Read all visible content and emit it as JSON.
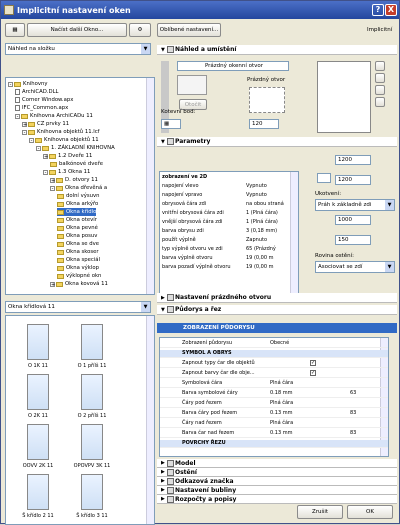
{
  "window": {
    "title": "Implicitní nastavení oken",
    "help": "?",
    "close": "X"
  },
  "left": {
    "load_button": "Načíst další Okno...",
    "view_combo": "Náhled na složku",
    "tree": [
      {
        "label": "Knihovny",
        "indent": 0,
        "type": "folder",
        "exp": "-"
      },
      {
        "label": "ArchiCAD.DLL",
        "indent": 1,
        "type": "file"
      },
      {
        "label": "Corner Window.apx",
        "indent": 1,
        "type": "file"
      },
      {
        "label": "IFC_Common.apx",
        "indent": 1,
        "type": "file"
      },
      {
        "label": "Knihovna ArchiCADu 11",
        "indent": 1,
        "type": "folder",
        "exp": "-"
      },
      {
        "label": "CZ prvky 11",
        "indent": 2,
        "type": "folder",
        "exp": "+"
      },
      {
        "label": "Knihovna objektů 11.lcf",
        "indent": 2,
        "type": "folder",
        "exp": "-"
      },
      {
        "label": "Knihovna objektů 11",
        "indent": 3,
        "type": "folder",
        "exp": "-"
      },
      {
        "label": "1. ZÁKLADNÍ KNIHOVNA",
        "indent": 4,
        "type": "folder",
        "exp": "-"
      },
      {
        "label": "1.2 Dveře 11",
        "indent": 5,
        "type": "folder",
        "exp": "+"
      },
      {
        "label": "balkónové dveře",
        "indent": 6,
        "type": "folder"
      },
      {
        "label": "1.3 Okna 11",
        "indent": 5,
        "type": "folder",
        "exp": "-"
      },
      {
        "label": "D. otvory 11",
        "indent": 6,
        "type": "folder",
        "exp": "+"
      },
      {
        "label": "Okna dřevěná a",
        "indent": 6,
        "type": "folder",
        "exp": "-"
      },
      {
        "label": "dolní výsuvn",
        "indent": 7,
        "type": "folder"
      },
      {
        "label": "Okna arkýřo",
        "indent": 7,
        "type": "folder"
      },
      {
        "label": "Okna křídlo",
        "indent": 7,
        "type": "folder",
        "selected": true
      },
      {
        "label": "Okna otevír",
        "indent": 7,
        "type": "folder"
      },
      {
        "label": "Okna pevné",
        "indent": 7,
        "type": "folder"
      },
      {
        "label": "Okna posuv",
        "indent": 7,
        "type": "folder"
      },
      {
        "label": "Okna se dve",
        "indent": 7,
        "type": "folder"
      },
      {
        "label": "Okna skoser",
        "indent": 7,
        "type": "folder"
      },
      {
        "label": "Okna speciál",
        "indent": 7,
        "type": "folder"
      },
      {
        "label": "Okna výklop",
        "indent": 7,
        "type": "folder"
      },
      {
        "label": "výklopné okn",
        "indent": 7,
        "type": "folder"
      },
      {
        "label": "Okna kovová 11",
        "indent": 6,
        "type": "folder",
        "exp": "+"
      }
    ],
    "gallery_combo": "Okna křídlová 11",
    "gallery": [
      "O 1K 11",
      "O 1 přílš 11",
      "O 2K 11",
      "O 2 přílš 11",
      "OOVV 2K 11",
      "OPOVPV 3K 11",
      "Š křídlo 2 11",
      "Š křídlo 3 11"
    ]
  },
  "right": {
    "favorites_button": "Oblíbené nastavení...",
    "default_label": "Implicitní",
    "section1": {
      "title": "Náhled a umístění",
      "ref_bar": "Prázdný okenní otvor",
      "ref_label": "Prázdný otvor",
      "flip_label": "Otočit",
      "anchor_label": "Kotevní bod:",
      "anchor_value": "120"
    },
    "section2": {
      "title": "Parametry",
      "width": "1200",
      "height": "1200",
      "anchor_label": "Ukotvení:",
      "anchor_value": "Práh k základně zdi",
      "sill": "1000",
      "depth": "150",
      "reveal_label": "Rovina ostění:",
      "reveal_value": "Asociovat se zdí"
    },
    "params": [
      {
        "name": "zobrazení ve 2D",
        "value": "",
        "bold": true
      },
      {
        "name": "napojení vlevo",
        "value": "Vypnuto"
      },
      {
        "name": "napojení vpravo",
        "value": "Vypnuto"
      },
      {
        "name": "obrysová čára zdi",
        "value": "na obou straná"
      },
      {
        "name": "vnitřní obrysová čára zdi",
        "value": "1 (Plná čára)"
      },
      {
        "name": "vnější obrysová čára zdi",
        "value": "1 (Plná čára)"
      },
      {
        "name": "barva obrysu zdi",
        "value": "3 (0,18 mm)"
      },
      {
        "name": "použít výplně",
        "value": "Zapnuto"
      },
      {
        "name": "typ výplně otvoru ve zdi",
        "value": "65 (Prázdný"
      },
      {
        "name": "barva výplně otvoru",
        "value": "19 (0,00 m"
      },
      {
        "name": "barva pozadí výplně otvoru",
        "value": "19 (0,00 m"
      }
    ],
    "section3": {
      "title": "Nastavení prázdného otvoru"
    },
    "section4": {
      "title": "Půdorys a řez"
    },
    "floor_header": "ZOBRAZENÍ PŮDORYSU",
    "floor_rows": [
      {
        "a": "Zobrazení půdorysu",
        "b": "Obecné",
        "c": "",
        "kind": "row"
      },
      {
        "a": "SYMBOL A OBRYS",
        "b": "",
        "c": "",
        "kind": "group"
      },
      {
        "a": "Zapnout typy čar dle objektů",
        "b": "",
        "c": "",
        "kind": "check"
      },
      {
        "a": "Zapnout barvy čar dle obje...",
        "b": "",
        "c": "",
        "kind": "check"
      },
      {
        "a": "Symbolová čára",
        "b": "Plná čára",
        "c": "",
        "kind": "row"
      },
      {
        "a": "Barva symbolové čáry",
        "b": "0.18 mm",
        "c": "63",
        "kind": "row"
      },
      {
        "a": "Čáry pod řezem",
        "b": "Plná čára",
        "c": "",
        "kind": "row"
      },
      {
        "a": "Barva čáry pod řezem",
        "b": "0.13 mm",
        "c": "83",
        "kind": "row"
      },
      {
        "a": "Čáry nad řezem",
        "b": "Plná čára",
        "c": "",
        "kind": "row"
      },
      {
        "a": "Barva čar nad řezem",
        "b": "0.13 mm",
        "c": "83",
        "kind": "row"
      },
      {
        "a": "POVRCHY ŘEZU",
        "b": "",
        "c": "",
        "kind": "group"
      }
    ],
    "bottom_sections": [
      "Model",
      "Ostění",
      "Odkazová značka",
      "Nastavení bubliny",
      "Rozpočty a popisy"
    ],
    "cancel": "Zrušit",
    "ok": "OK"
  }
}
